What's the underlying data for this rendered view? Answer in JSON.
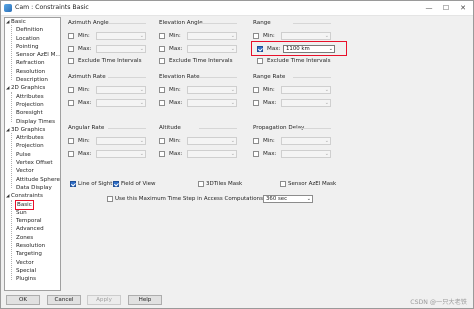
{
  "window": {
    "title": "Cam : Constraints Basic",
    "controls": [
      "—",
      "☐",
      "✕"
    ]
  },
  "tree": {
    "groups": [
      {
        "label": "Basic",
        "items": [
          "Definition",
          "Location",
          "Pointing",
          "Sensor AzEl M...",
          "Refraction",
          "Resolution",
          "Description"
        ]
      },
      {
        "label": "2D Graphics",
        "items": [
          "Attributes",
          "Projection",
          "Boresight",
          "Display Times"
        ]
      },
      {
        "label": "3D Graphics",
        "items": [
          "Attributes",
          "Projection",
          "Pulse",
          "Vertex Offset",
          "Vector",
          "Attitude Sphere",
          "Data Display"
        ]
      },
      {
        "label": "Constraints",
        "items": [
          "Basic",
          "Sun",
          "Temporal",
          "Advanced",
          "Zones",
          "Resolution",
          "Targeting",
          "Vector",
          "Special",
          "Plugins"
        ]
      }
    ],
    "selected": "Constraints / Basic"
  },
  "sections": {
    "azimuth_angle": {
      "title": "Azimuth Angle",
      "min": "Min:",
      "max": "Max:",
      "exclude": "Exclude Time Intervals"
    },
    "elevation_angle": {
      "title": "Elevation Angle",
      "min": "Min:",
      "max": "Max:",
      "exclude": "Exclude Time Intervals"
    },
    "range": {
      "title": "Range",
      "min": "Min:",
      "max": "Max:",
      "max_value": "1100 km",
      "max_checked": true,
      "exclude": "Exclude Time Intervals"
    },
    "azimuth_rate": {
      "title": "Azimuth Rate",
      "min": "Min:",
      "max": "Max:"
    },
    "elevation_rate": {
      "title": "Elevation Rate",
      "min": "Min:",
      "max": "Max:"
    },
    "range_rate": {
      "title": "Range Rate",
      "min": "Min:",
      "max": "Max:"
    },
    "angular_rate": {
      "title": "Angular Rate",
      "min": "Min:",
      "max": "Max:"
    },
    "altitude": {
      "title": "Altitude",
      "min": "Min:",
      "max": "Max:"
    },
    "propagation_delay": {
      "title": "Propagation Delay",
      "min": "Min:",
      "max": "Max:"
    }
  },
  "options": {
    "line_of_sight": {
      "label": "Line of Sight",
      "checked": true
    },
    "field_of_view": {
      "label": "Field of View",
      "checked": true
    },
    "tiles_mask": {
      "label": "3DTiles Mask",
      "checked": false
    },
    "sensor_azel_mask": {
      "label": "Sensor AzEl Mask",
      "checked": false
    },
    "max_time_step": {
      "label": "Use this Maximum Time Step in Access Computations",
      "checked": false,
      "value": "360 sec"
    }
  },
  "buttons": {
    "ok": "OK",
    "cancel": "Cancel",
    "apply": "Apply",
    "help": "Help"
  },
  "watermark": "CSDN @一只大老铁",
  "colors": {
    "accent": "#2e6ec8",
    "highlight": "#e8102a"
  }
}
